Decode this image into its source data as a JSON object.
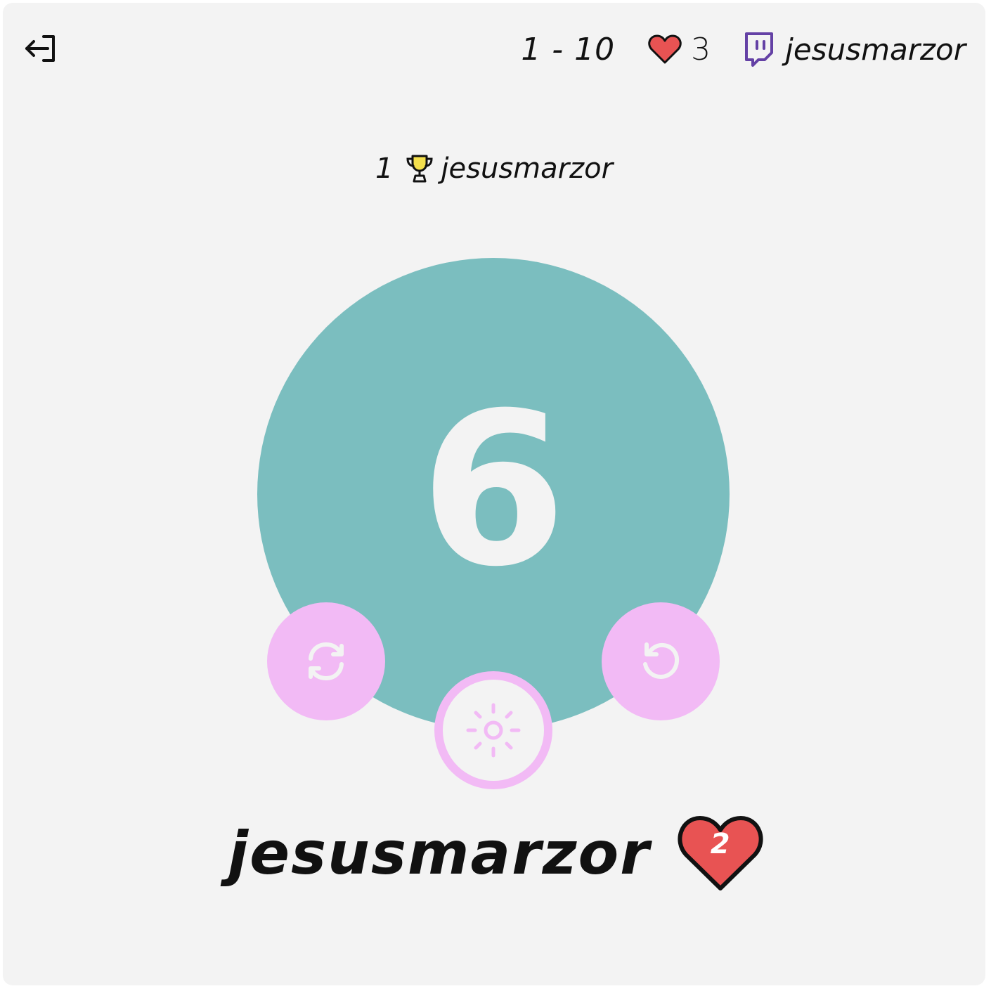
{
  "header": {
    "range": "1 - 10",
    "lives": "3",
    "username": "jesusmarzor"
  },
  "leaderboard": {
    "rank": "1",
    "name": "jesusmarzor"
  },
  "game": {
    "number": "6"
  },
  "player": {
    "name": "jesusmarzor",
    "lives": "2"
  },
  "icons": {
    "exit": "exit-icon",
    "heart": "heart-icon",
    "twitch": "twitch-icon",
    "trophy": "trophy-icon",
    "refresh": "refresh-icon",
    "undo": "undo-icon",
    "theme": "sun-icon"
  },
  "colors": {
    "background": "#f3f3f3",
    "circle": "#7bbebf",
    "button": "#f2baf5",
    "heart": "#e85353",
    "twitch": "#6441a5",
    "trophy": "#f4e04d"
  }
}
